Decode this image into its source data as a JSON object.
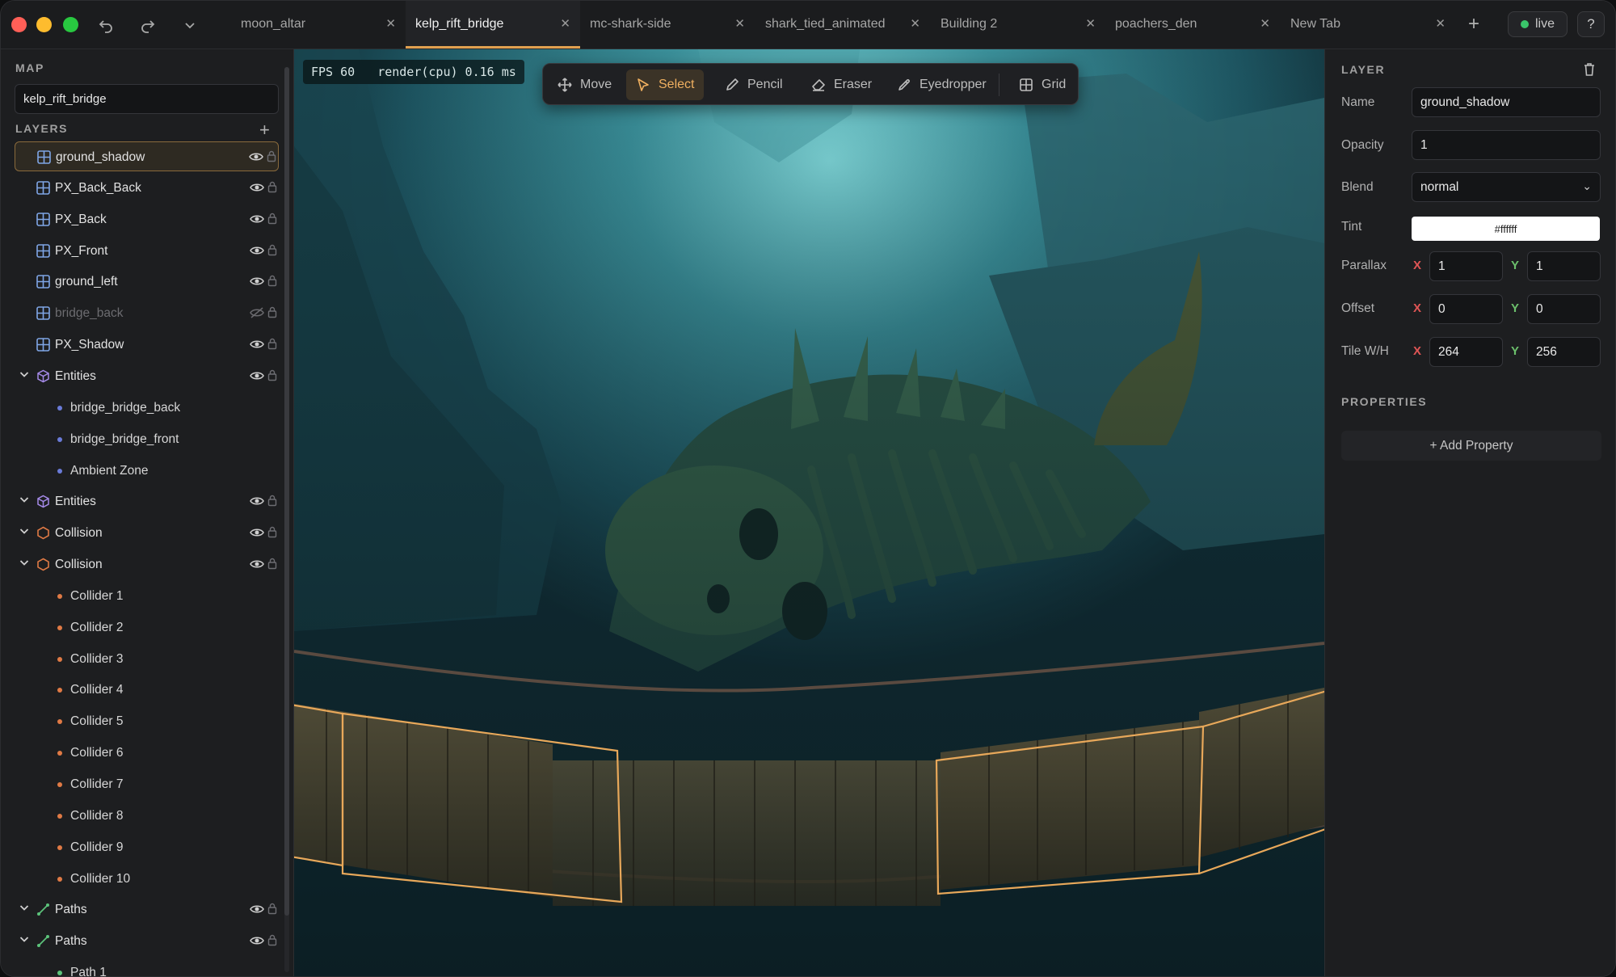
{
  "tabs": [
    {
      "name": "moon_altar",
      "active": false
    },
    {
      "name": "kelp_rift_bridge",
      "active": true
    },
    {
      "name": "mc-shark-side",
      "active": false
    },
    {
      "name": "shark_tied_animated",
      "active": false
    },
    {
      "name": "Building 2",
      "active": false
    },
    {
      "name": "poachers_den",
      "active": false
    },
    {
      "name": "New Tab",
      "active": false
    }
  ],
  "live_label": "live",
  "help_label": "?",
  "left_panel": {
    "map_title": "MAP",
    "map_name": "kelp_rift_bridge",
    "layers_title": "LAYERS",
    "layers": [
      {
        "label": "ground_shadow",
        "kind": "tile",
        "selected": true
      },
      {
        "label": "PX_Back_Back",
        "kind": "tile"
      },
      {
        "label": "PX_Back",
        "kind": "tile"
      },
      {
        "label": "PX_Front",
        "kind": "tile"
      },
      {
        "label": "ground_left",
        "kind": "tile"
      },
      {
        "label": "bridge_back",
        "kind": "tile",
        "hidden": true
      },
      {
        "label": "PX_Shadow",
        "kind": "tile"
      },
      {
        "label": "Entities",
        "kind": "entity"
      },
      {
        "label": "bridge_bridge_back",
        "kind": "child"
      },
      {
        "label": "bridge_bridge_front",
        "kind": "child"
      },
      {
        "label": "Ambient Zone",
        "kind": "child"
      },
      {
        "label": "Entities",
        "kind": "entity"
      },
      {
        "label": "Collision",
        "kind": "collision"
      },
      {
        "label": "Collision",
        "kind": "collision"
      },
      {
        "label": "Collider 1",
        "kind": "coll-child"
      },
      {
        "label": "Collider 2",
        "kind": "coll-child"
      },
      {
        "label": "Collider 3",
        "kind": "coll-child"
      },
      {
        "label": "Collider 4",
        "kind": "coll-child"
      },
      {
        "label": "Collider 5",
        "kind": "coll-child"
      },
      {
        "label": "Collider 6",
        "kind": "coll-child"
      },
      {
        "label": "Collider 7",
        "kind": "coll-child"
      },
      {
        "label": "Collider 8",
        "kind": "coll-child"
      },
      {
        "label": "Collider 9",
        "kind": "coll-child"
      },
      {
        "label": "Collider 10",
        "kind": "coll-child"
      },
      {
        "label": "Paths",
        "kind": "path"
      },
      {
        "label": "Paths",
        "kind": "path"
      },
      {
        "label": "Path 1",
        "kind": "path-child"
      }
    ]
  },
  "canvas": {
    "fps": "FPS 60",
    "render": "render(cpu) 0.16 ms"
  },
  "toolbar": {
    "tools": [
      {
        "label": "Move",
        "icon": "move-icon"
      },
      {
        "label": "Select",
        "icon": "cursor-icon",
        "active": true
      },
      {
        "label": "Pencil",
        "icon": "pencil-icon"
      },
      {
        "label": "Eraser",
        "icon": "eraser-icon"
      },
      {
        "label": "Eyedropper",
        "icon": "eyedropper-icon"
      },
      {
        "label": "Grid",
        "icon": "grid-icon"
      }
    ]
  },
  "right_panel": {
    "layer_title": "LAYER",
    "name_label": "Name",
    "name_value": "ground_shadow",
    "opacity_label": "Opacity",
    "opacity_value": "1",
    "blend_label": "Blend",
    "blend_value": "normal",
    "tint_label": "Tint",
    "tint_value": "#ffffff",
    "parallax_label": "Parallax",
    "parallax_x": "1",
    "parallax_y": "1",
    "offset_label": "Offset",
    "offset_x": "0",
    "offset_y": "0",
    "tile_label": "Tile W/H",
    "tile_w": "264",
    "tile_h": "256",
    "axis_x": "X",
    "axis_y": "Y",
    "properties_title": "PROPERTIES",
    "add_property": "+ Add Property"
  },
  "colors": {
    "accent": "#e0a050",
    "live": "#3ac56a",
    "axis_x": "#e05555",
    "axis_y": "#6cc06c"
  }
}
